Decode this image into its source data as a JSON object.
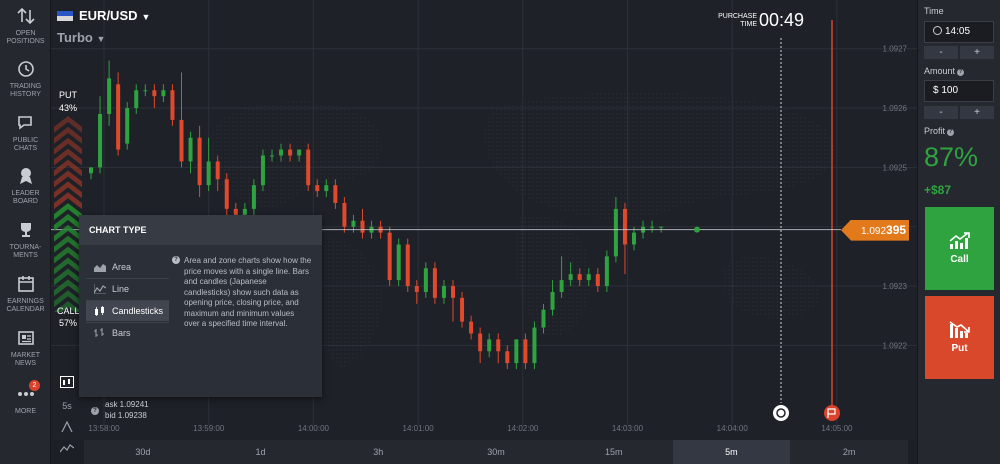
{
  "nav": [
    {
      "label": "OPEN\nPOSITIONS",
      "icon": "arrows-updown-icon"
    },
    {
      "label": "TRADING\nHISTORY",
      "icon": "history-icon"
    },
    {
      "label": "PUBLIC\nCHATS",
      "icon": "chat-icon"
    },
    {
      "label": "LEADER\nBOARD",
      "icon": "medal-icon"
    },
    {
      "label": "TOURNA-\nMENTS",
      "icon": "trophy-icon"
    },
    {
      "label": "EARNINGS\nCALENDAR",
      "icon": "calendar-icon"
    },
    {
      "label": "MARKET\nNEWS",
      "icon": "news-icon"
    },
    {
      "label": "MORE",
      "icon": "more-icon",
      "badge": "2"
    }
  ],
  "header": {
    "pair": "EUR/USD",
    "mode": "Turbo",
    "purchase_label": "PURCHASE\nTIME",
    "purchase_time": "00:49"
  },
  "sentiment": {
    "put_label": "PUT",
    "put_pct": "43%",
    "call_label": "CALL",
    "call_pct": "57%"
  },
  "price": {
    "prefix": "1.092",
    "suffix": "395"
  },
  "chart_type": {
    "title": "CHART TYPE",
    "options": [
      "Area",
      "Line",
      "Candlesticks",
      "Bars"
    ],
    "selected": "Candlesticks",
    "description": "Area and zone charts show how the price moves with a single line. Bars and candles (Japanese candlesticks) show such data as opening price, closing price, and maximum and minimum values over a specified time interval."
  },
  "quote": {
    "ask": "ask 1.09241",
    "bid": "bid 1.09238"
  },
  "tools": {
    "interval": "5s"
  },
  "timeframes": [
    "30d",
    "1d",
    "3h",
    "30m",
    "15m",
    "5m",
    "2m"
  ],
  "timeframe_selected": "5m",
  "panel": {
    "time_label": "Time",
    "time_value": "14:05",
    "amount_label": "Amount",
    "amount_value": "$ 100",
    "minus": "-",
    "plus": "+",
    "profit_label": "Profit",
    "profit_pct": "87%",
    "profit_amount": "+$87",
    "call_label": "Call",
    "put_label": "Put"
  },
  "colors": {
    "up": "#2fa340",
    "down": "#e0492b",
    "price_tag": "#e27a1c",
    "expiry_line": "#d9432b"
  },
  "chart_data": {
    "type": "candlestick",
    "y_ticks": [
      "1.0927",
      "1.0926",
      "1.0925",
      "1.0924",
      "1.0923",
      "1.0922"
    ],
    "x_ticks": [
      "13:58:00",
      "13:59:00",
      "14:00:00",
      "14:01:00",
      "14:02:00",
      "14:03:00",
      "14:04:00",
      "14:05:00"
    ],
    "current_price": 1.092395,
    "ylim": [
      1.09215,
      1.09274
    ],
    "candles": [
      {
        "o": 1.09249,
        "c": 1.0925,
        "h": 1.0925,
        "l": 1.09248
      },
      {
        "o": 1.0925,
        "c": 1.09259,
        "h": 1.09262,
        "l": 1.09249
      },
      {
        "o": 1.09259,
        "c": 1.09265,
        "h": 1.09268,
        "l": 1.09257
      },
      {
        "o": 1.09264,
        "c": 1.09253,
        "h": 1.09266,
        "l": 1.09252
      },
      {
        "o": 1.09254,
        "c": 1.0926,
        "h": 1.09261,
        "l": 1.09253
      },
      {
        "o": 1.0926,
        "c": 1.09263,
        "h": 1.09264,
        "l": 1.09259
      },
      {
        "o": 1.09263,
        "c": 1.09263,
        "h": 1.09264,
        "l": 1.09262
      },
      {
        "o": 1.09263,
        "c": 1.09262,
        "h": 1.09264,
        "l": 1.0926
      },
      {
        "o": 1.09262,
        "c": 1.09263,
        "h": 1.09264,
        "l": 1.09261
      },
      {
        "o": 1.09263,
        "c": 1.09258,
        "h": 1.09264,
        "l": 1.09257
      },
      {
        "o": 1.09258,
        "c": 1.09251,
        "h": 1.09266,
        "l": 1.0925
      },
      {
        "o": 1.09251,
        "c": 1.09255,
        "h": 1.09256,
        "l": 1.09249
      },
      {
        "o": 1.09255,
        "c": 1.09247,
        "h": 1.09257,
        "l": 1.09245
      },
      {
        "o": 1.09247,
        "c": 1.09251,
        "h": 1.09255,
        "l": 1.09246
      },
      {
        "o": 1.09251,
        "c": 1.09248,
        "h": 1.09252,
        "l": 1.09246
      },
      {
        "o": 1.09248,
        "c": 1.09243,
        "h": 1.09249,
        "l": 1.09238
      },
      {
        "o": 1.09243,
        "c": 1.09242,
        "h": 1.09244,
        "l": 1.09241
      },
      {
        "o": 1.09242,
        "c": 1.09243,
        "h": 1.09244,
        "l": 1.09241
      },
      {
        "o": 1.09243,
        "c": 1.09247,
        "h": 1.09248,
        "l": 1.09242
      },
      {
        "o": 1.09247,
        "c": 1.09252,
        "h": 1.09253,
        "l": 1.09246
      },
      {
        "o": 1.09252,
        "c": 1.09252,
        "h": 1.09253,
        "l": 1.09251
      },
      {
        "o": 1.09252,
        "c": 1.09253,
        "h": 1.09254,
        "l": 1.09251
      },
      {
        "o": 1.09253,
        "c": 1.09252,
        "h": 1.09254,
        "l": 1.09251
      },
      {
        "o": 1.09252,
        "c": 1.09253,
        "h": 1.09253,
        "l": 1.09251
      },
      {
        "o": 1.09253,
        "c": 1.09247,
        "h": 1.09254,
        "l": 1.09246
      },
      {
        "o": 1.09247,
        "c": 1.09246,
        "h": 1.09248,
        "l": 1.09245
      },
      {
        "o": 1.09246,
        "c": 1.09247,
        "h": 1.09248,
        "l": 1.09245
      },
      {
        "o": 1.09247,
        "c": 1.09244,
        "h": 1.09248,
        "l": 1.09243
      },
      {
        "o": 1.09244,
        "c": 1.0924,
        "h": 1.09245,
        "l": 1.09239
      },
      {
        "o": 1.0924,
        "c": 1.09241,
        "h": 1.09242,
        "l": 1.09239
      },
      {
        "o": 1.09241,
        "c": 1.09239,
        "h": 1.09243,
        "l": 1.09238
      },
      {
        "o": 1.09239,
        "c": 1.0924,
        "h": 1.09241,
        "l": 1.09238
      },
      {
        "o": 1.0924,
        "c": 1.09239,
        "h": 1.09241,
        "l": 1.09238
      },
      {
        "o": 1.09239,
        "c": 1.09231,
        "h": 1.0924,
        "l": 1.0923
      },
      {
        "o": 1.09231,
        "c": 1.09237,
        "h": 1.09238,
        "l": 1.0923
      },
      {
        "o": 1.09237,
        "c": 1.0923,
        "h": 1.09238,
        "l": 1.09229
      },
      {
        "o": 1.0923,
        "c": 1.09229,
        "h": 1.09231,
        "l": 1.09227
      },
      {
        "o": 1.09229,
        "c": 1.09233,
        "h": 1.09234,
        "l": 1.09228
      },
      {
        "o": 1.09233,
        "c": 1.09228,
        "h": 1.09234,
        "l": 1.09227
      },
      {
        "o": 1.09228,
        "c": 1.0923,
        "h": 1.09231,
        "l": 1.09227
      },
      {
        "o": 1.0923,
        "c": 1.09228,
        "h": 1.09231,
        "l": 1.09224
      },
      {
        "o": 1.09228,
        "c": 1.09224,
        "h": 1.09229,
        "l": 1.09223
      },
      {
        "o": 1.09224,
        "c": 1.09222,
        "h": 1.09225,
        "l": 1.09221
      },
      {
        "o": 1.09222,
        "c": 1.09219,
        "h": 1.09223,
        "l": 1.09217
      },
      {
        "o": 1.09219,
        "c": 1.09221,
        "h": 1.09222,
        "l": 1.09218
      },
      {
        "o": 1.09221,
        "c": 1.09219,
        "h": 1.09222,
        "l": 1.09217
      },
      {
        "o": 1.09219,
        "c": 1.09217,
        "h": 1.0922,
        "l": 1.09216
      },
      {
        "o": 1.09217,
        "c": 1.09221,
        "h": 1.09221,
        "l": 1.09216
      },
      {
        "o": 1.09221,
        "c": 1.09217,
        "h": 1.09222,
        "l": 1.09216
      },
      {
        "o": 1.09217,
        "c": 1.09223,
        "h": 1.09224,
        "l": 1.09216
      },
      {
        "o": 1.09223,
        "c": 1.09226,
        "h": 1.09227,
        "l": 1.09222
      },
      {
        "o": 1.09226,
        "c": 1.09229,
        "h": 1.09231,
        "l": 1.09225
      },
      {
        "o": 1.09229,
        "c": 1.09231,
        "h": 1.09235,
        "l": 1.09228
      },
      {
        "o": 1.09231,
        "c": 1.09232,
        "h": 1.09234,
        "l": 1.0923
      },
      {
        "o": 1.09232,
        "c": 1.09231,
        "h": 1.09233,
        "l": 1.0923
      },
      {
        "o": 1.09231,
        "c": 1.09232,
        "h": 1.09233,
        "l": 1.0923
      },
      {
        "o": 1.09232,
        "c": 1.0923,
        "h": 1.09233,
        "l": 1.09229
      },
      {
        "o": 1.0923,
        "c": 1.09235,
        "h": 1.09236,
        "l": 1.09229
      },
      {
        "o": 1.09235,
        "c": 1.09243,
        "h": 1.09245,
        "l": 1.09234
      },
      {
        "o": 1.09243,
        "c": 1.09237,
        "h": 1.09244,
        "l": 1.09232
      },
      {
        "o": 1.09237,
        "c": 1.09239,
        "h": 1.0924,
        "l": 1.09236
      },
      {
        "o": 1.09239,
        "c": 1.0924,
        "h": 1.09241,
        "l": 1.09238
      },
      {
        "o": 1.0924,
        "c": 1.0924,
        "h": 1.09241,
        "l": 1.09239
      },
      {
        "o": 1.0924,
        "c": 1.0924,
        "h": 1.0924,
        "l": 1.09239
      }
    ]
  }
}
